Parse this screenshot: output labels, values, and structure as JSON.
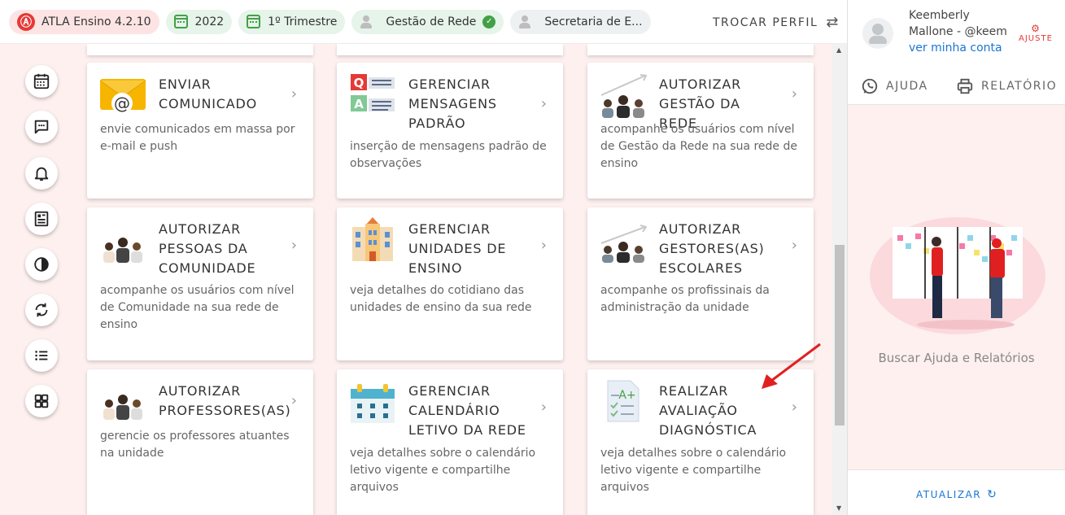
{
  "topbar": {
    "app_name": "ATLA Ensino 4.2.10",
    "year": "2022",
    "period": "1º Trimestre",
    "profile": "Gestão de Rede",
    "secretaria": "Secretaria de E...",
    "switch_profile": "TROCAR PERFIL"
  },
  "sidebar": {
    "items": [
      {
        "icon": "calendar-icon"
      },
      {
        "icon": "chat-icon"
      },
      {
        "icon": "bell-icon"
      },
      {
        "icon": "newspaper-icon"
      },
      {
        "icon": "contrast-icon"
      },
      {
        "icon": "sync-icon"
      },
      {
        "icon": "list-icon"
      },
      {
        "icon": "grid-icon"
      }
    ]
  },
  "cards": [
    {
      "title": "ENVIAR COMUNICADO",
      "description": "envie comunicados em massa por e-mail e push",
      "icon": "email-icon"
    },
    {
      "title": "GERENCIAR MENSAGENS PADRÃO",
      "description": "inserção de mensagens padrão de observações",
      "icon": "qa-icon"
    },
    {
      "title": "AUTORIZAR GESTÃO DA REDE",
      "description": "acompanhe os usuários com nível de Gestão da Rede na sua rede de ensino",
      "icon": "people-growth-icon"
    },
    {
      "title": "AUTORIZAR PESSOAS DA COMUNIDADE",
      "description": "acompanhe os usuários com nível de Comunidade na sua rede de ensino",
      "icon": "people-icon"
    },
    {
      "title": "GERENCIAR UNIDADES DE ENSINO",
      "description": "veja detalhes do cotidiano das unidades de ensino da sua rede",
      "icon": "school-building-icon"
    },
    {
      "title": "AUTORIZAR GESTORES(AS) ESCOLARES",
      "description": "acompanhe os profissinais da administração da unidade",
      "icon": "people-growth-icon"
    },
    {
      "title": "AUTORIZAR PROFESSORES(AS)",
      "description": "gerencie os professores atuantes na unidade",
      "icon": "people-icon"
    },
    {
      "title": "GERENCIAR CALENDÁRIO LETIVO DA REDE",
      "description": "veja detalhes sobre o calendário letivo vigente e compartilhe arquivos",
      "icon": "calendar-board-icon"
    },
    {
      "title": "REALIZAR AVALIAÇÃO DIAGNÓSTICA",
      "description": "veja detalhes sobre o calendário letivo vigente e compartilhe arquivos",
      "icon": "test-sheet-icon"
    }
  ],
  "right_panel": {
    "user_name": "Keemberly Mallone - @keem",
    "account_link": "ver minha conta",
    "ajuste_label": "AJUSTE",
    "help_label": "AJUDA",
    "report_label": "RELATÓRIO",
    "help_caption": "Buscar Ajuda e Relatórios",
    "refresh_label": "ATUALIZAR"
  },
  "colors": {
    "brand_red": "#e53935",
    "link_blue": "#1976d2",
    "chip_green_bg": "#e6f4ea",
    "page_bg": "#fdf0ef"
  }
}
